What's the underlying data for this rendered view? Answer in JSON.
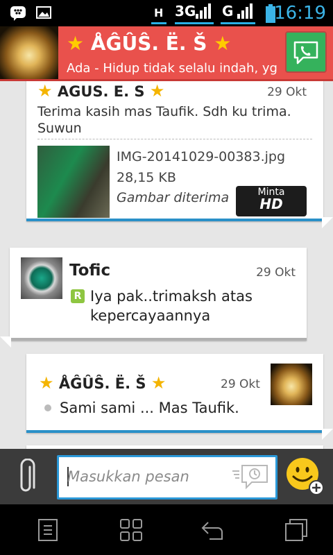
{
  "status_bar": {
    "network_1": "H",
    "network_2": "3G",
    "network_3": "G",
    "time": "16:19"
  },
  "header": {
    "contact_name_prefix": "★",
    "contact_name": "ÅĜÛŜ. Ë. Š",
    "contact_name_suffix": "★",
    "status_message": "Ada - Hidup tidak selalu indah, yg"
  },
  "messages": [
    {
      "sender": "AGUS. E. S",
      "date": "29 Okt",
      "text": "Terima kasih mas Taufik. Sdh ku trima. Suwun",
      "attachment": {
        "file_name": "IMG-20141029-00383.jpg",
        "file_size": "28,15 KB",
        "status": "Gambar diterima",
        "button_top": "Minta",
        "button_bottom": "HD"
      }
    },
    {
      "sender": "Tofic",
      "date": "29 Okt",
      "badge": "R",
      "text_line1": "Iya pak..trimaksh atas",
      "text_line2": "kepercayaannya"
    },
    {
      "sender": "ÅĜÛŜ. Ë. Š",
      "date": "29 Okt",
      "text": "Sami sami ... Mas Taufik."
    }
  ],
  "composer": {
    "placeholder": "Masukkan pesan"
  },
  "colors": {
    "header_bg": "#e9514c",
    "accent_blue": "#2a98d8",
    "call_green": "#35b25c"
  }
}
